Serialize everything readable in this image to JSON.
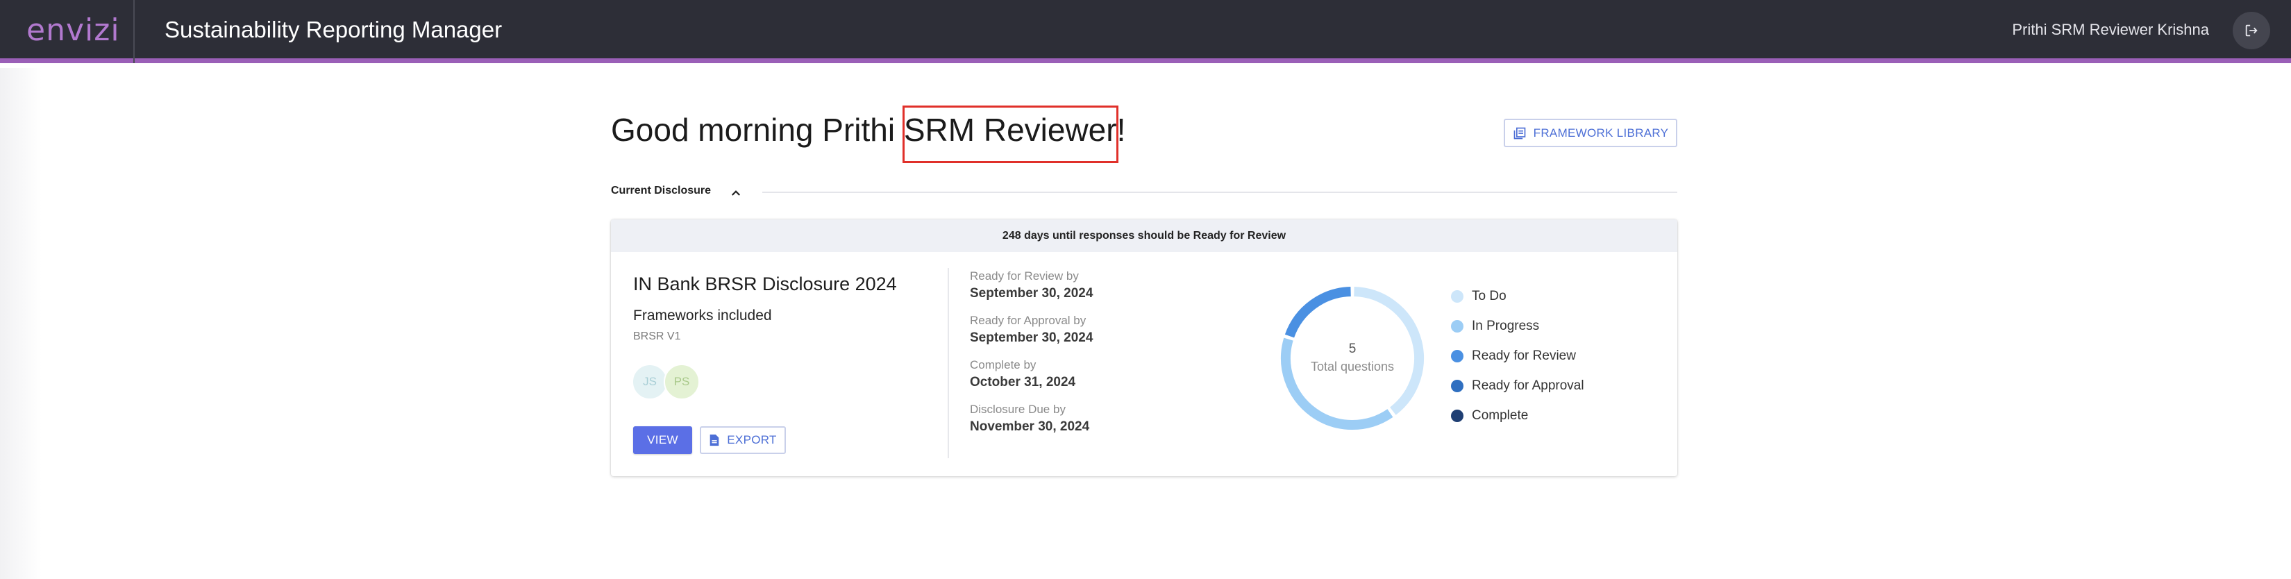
{
  "header": {
    "logo": "envizi",
    "app_title": "Sustainability Reporting Manager",
    "user_name": "Prithi SRM Reviewer Krishna",
    "logout_icon": "logout-icon"
  },
  "greeting": "Good morning Prithi SRM Reviewer!",
  "framework_library_button": "FRAMEWORK LIBRARY",
  "section": {
    "label": "Current Disclosure",
    "toggle_icon": "chevron-up-icon"
  },
  "card": {
    "banner": "248 days until responses should be Ready for Review",
    "title": "IN Bank BRSR Disclosure 2024",
    "frameworks_heading": "Frameworks included",
    "framework": "BRSR V1",
    "avatars": [
      "JS",
      "PS"
    ],
    "view_button": "VIEW",
    "export_button": "EXPORT",
    "dates": [
      {
        "label": "Ready for Review by",
        "value": "September 30, 2024"
      },
      {
        "label": "Ready for Approval by",
        "value": "September 30, 2024"
      },
      {
        "label": "Complete by",
        "value": "October 31, 2024"
      },
      {
        "label": "Disclosure Due by",
        "value": "November 30, 2024"
      }
    ],
    "total_questions": "5",
    "total_questions_label": "Total questions",
    "legend": [
      {
        "label": "To Do",
        "color": "#cde6fa"
      },
      {
        "label": "In Progress",
        "color": "#9ccdf5"
      },
      {
        "label": "Ready for Review",
        "color": "#4a90e2"
      },
      {
        "label": "Ready for Approval",
        "color": "#2f6fc0"
      },
      {
        "label": "Complete",
        "color": "#1f3f73"
      }
    ]
  },
  "chart_data": {
    "type": "pie",
    "title": "",
    "categories": [
      "To Do",
      "In Progress",
      "Ready for Review",
      "Ready for Approval",
      "Complete"
    ],
    "values": [
      2,
      2,
      1,
      0,
      0
    ],
    "total": 5,
    "colors": [
      "#cde6fa",
      "#9ccdf5",
      "#4a90e2",
      "#2f6fc0",
      "#1f3f73"
    ]
  }
}
